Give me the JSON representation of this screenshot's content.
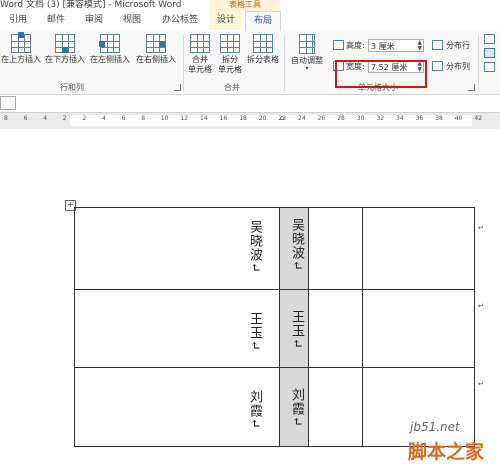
{
  "title": {
    "text": "Word 文档 (3) [兼容模式] - Microsoft Word",
    "context_group": "表格工具"
  },
  "tabs": [
    {
      "label": "引用"
    },
    {
      "label": "邮件"
    },
    {
      "label": "审阅"
    },
    {
      "label": "视图"
    },
    {
      "label": "办公标签"
    },
    {
      "label": "设计"
    },
    {
      "label": "布局"
    }
  ],
  "ribbon": {
    "rows_cols": {
      "insert_above": "在上方插入",
      "insert_below": "在下方插入",
      "insert_left": "在左侧插入",
      "insert_right": "在右侧插入",
      "group_label": "行和列"
    },
    "merge": {
      "merge_cells_1": "合并",
      "merge_cells_2": "单元格",
      "split_cells_1": "拆分",
      "split_cells_2": "单元格",
      "split_table": "拆分表格",
      "group_label": "合并"
    },
    "cell_size": {
      "autofit": "自动调整",
      "height_label": "高度:",
      "height_value": "3 厘米",
      "width_label": "宽度:",
      "width_value": "7.52 厘米",
      "distribute_rows": "分布行",
      "distribute_cols": "分布列",
      "group_label": "单元格大小"
    }
  },
  "ruler": {
    "ticks": [
      "8",
      "6",
      "4",
      "2",
      "2",
      "4",
      "6",
      "8",
      "10",
      "12",
      "14",
      "16",
      "18",
      "20",
      "22",
      "24",
      "26",
      "28",
      "30",
      "32",
      "34",
      "36",
      "38",
      "40",
      "42"
    ]
  },
  "table": {
    "rows": [
      {
        "left_text": "吴晓波↵",
        "right_text": "吴晓波↵"
      },
      {
        "left_text": "王玉↵",
        "right_text": "王玉↵"
      },
      {
        "left_text": "刘霞↵",
        "right_text": "刘霞↵"
      }
    ],
    "para_mark": "↵"
  },
  "watermark": {
    "line1": "jb51.net",
    "line2": "脚本之家"
  }
}
